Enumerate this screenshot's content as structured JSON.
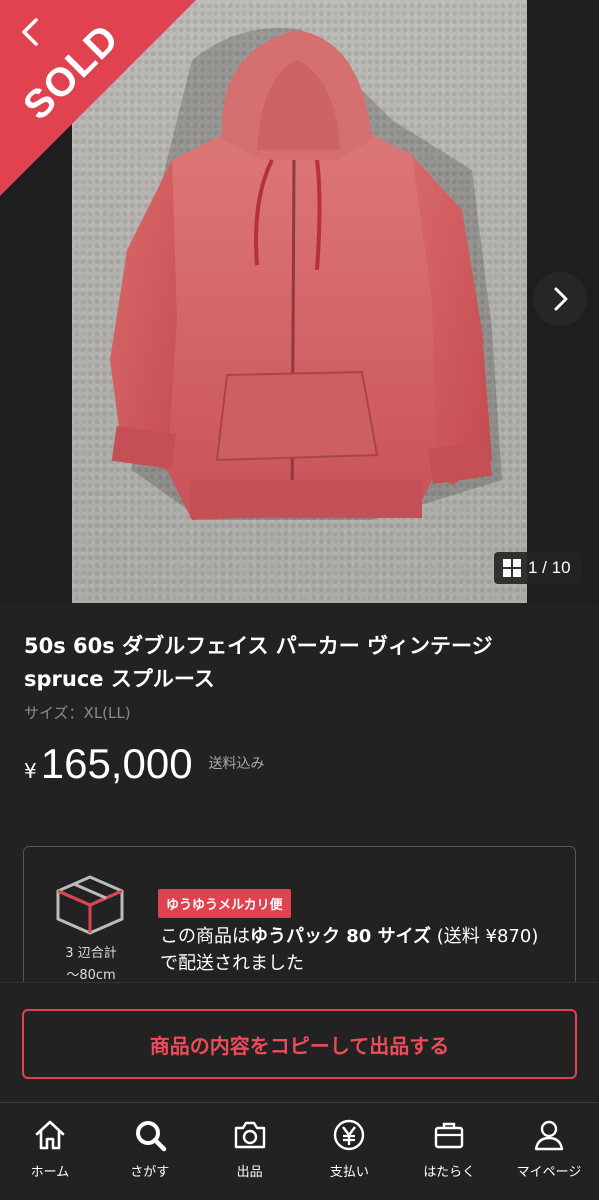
{
  "header": {
    "sold_label": "SOLD"
  },
  "gallery": {
    "counter": "1 / 10",
    "current_index": 1,
    "total": 10
  },
  "item": {
    "title": "50s 60s ダブルフェイス パーカー ヴィンテージ spruce スプルース",
    "size": "サイズ：XL(LL)",
    "price_symbol": "¥",
    "price": "165,000",
    "shipping_note": "送料込み"
  },
  "shipping": {
    "dimension_line1": "3 辺合計",
    "dimension_line2": "〜80cm",
    "badge": "ゆうゆうメルカリ便",
    "desc_prefix": "この商品は",
    "desc_bold": "ゆうパック 80 サイズ",
    "desc_suffix": " (送料 ¥870) で配送されました"
  },
  "actions": {
    "copy_listing": "商品の内容をコピーして出品する"
  },
  "tabbar": {
    "items": [
      {
        "label": "ホーム",
        "icon": "home-icon"
      },
      {
        "label": "さがす",
        "icon": "search-icon"
      },
      {
        "label": "出品",
        "icon": "camera-icon"
      },
      {
        "label": "支払い",
        "icon": "yen-icon"
      },
      {
        "label": "はたらく",
        "icon": "briefcase-icon"
      },
      {
        "label": "マイページ",
        "icon": "person-icon"
      }
    ]
  },
  "colors": {
    "accent": "#e0424f",
    "background": "#222222",
    "subtext": "#8a8a8a"
  }
}
